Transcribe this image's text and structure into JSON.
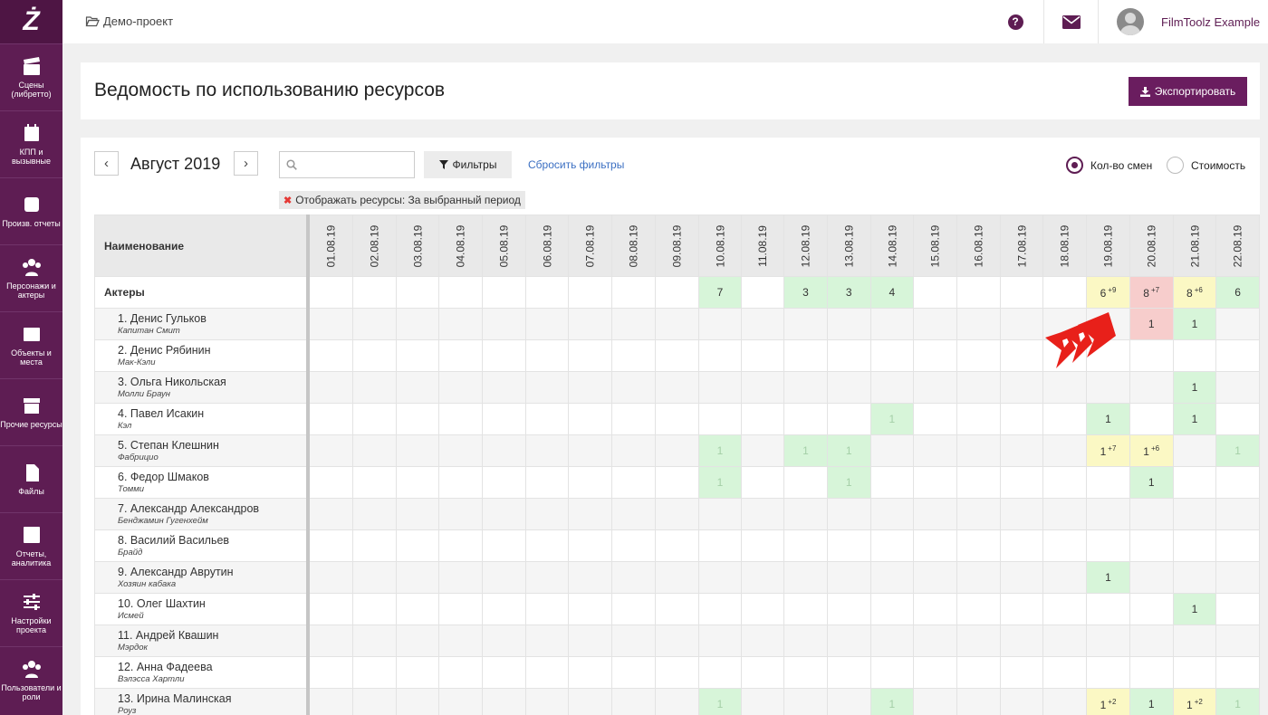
{
  "app": {
    "logo": "Ż"
  },
  "sidebar": {
    "items": [
      {
        "label": "Сцены (либретто)",
        "icon": "clapperboard-icon"
      },
      {
        "label": "КПП и вызывные",
        "icon": "calendar-icon"
      },
      {
        "label": "Произв. отчеты",
        "icon": "check-square-icon"
      },
      {
        "label": "Персонажи и актеры",
        "icon": "users-icon"
      },
      {
        "label": "Объекты и места",
        "icon": "image-icon"
      },
      {
        "label": "Прочие ресурсы",
        "icon": "archive-icon"
      },
      {
        "label": "Файлы",
        "icon": "file-icon"
      },
      {
        "label": "Отчеты, аналитика",
        "icon": "bar-chart-icon"
      },
      {
        "label": "Настройки проекта",
        "icon": "sliders-icon"
      },
      {
        "label": "Пользователи и роли",
        "icon": "user-group-icon"
      }
    ]
  },
  "topbar": {
    "breadcrumb": "Демо-проект",
    "help": "?",
    "user_name": "FilmToolz Example"
  },
  "header": {
    "title": "Ведомость по использованию ресурсов",
    "export_label": "Экспортировать"
  },
  "toolbar": {
    "prev": "‹",
    "next": "›",
    "month": "Август 2019",
    "search_placeholder": "",
    "filters_label": "Фильтры",
    "reset_label": "Сбросить фильтры",
    "radio_shifts": "Кол-во смен",
    "radio_cost": "Стоимость",
    "selected_radio": "shifts",
    "filter_tag": "Отображать ресурсы:  За выбранный период"
  },
  "grid": {
    "name_header": "Наименование",
    "dates": [
      "01.08.19",
      "02.08.19",
      "03.08.19",
      "04.08.19",
      "05.08.19",
      "06.08.19",
      "07.08.19",
      "08.08.19",
      "09.08.19",
      "10.08.19",
      "11.08.19",
      "12.08.19",
      "13.08.19",
      "14.08.19",
      "15.08.19",
      "16.08.19",
      "17.08.19",
      "18.08.19",
      "19.08.19",
      "20.08.19",
      "21.08.19",
      "22.08.19"
    ],
    "group": {
      "name": "Актеры",
      "cells": {
        "9": {
          "v": "7",
          "c": "g"
        },
        "11": {
          "v": "3",
          "c": "g"
        },
        "12": {
          "v": "3",
          "c": "g"
        },
        "13": {
          "v": "4",
          "c": "g"
        },
        "18": {
          "v": "6",
          "s": "+9",
          "c": "y"
        },
        "19": {
          "v": "8",
          "s": "+7",
          "c": "r"
        },
        "20": {
          "v": "8",
          "s": "+6",
          "c": "y"
        },
        "21": {
          "v": "6",
          "c": "g"
        }
      }
    },
    "rows": [
      {
        "name": "1. Денис Гульков",
        "role": "Капитан Смит",
        "cells": {
          "19": {
            "v": "1",
            "c": "r"
          },
          "20": {
            "v": "1",
            "c": "g"
          }
        }
      },
      {
        "name": "2. Денис Рябинин",
        "role": "Мак-Кэли",
        "cells": {}
      },
      {
        "name": "3. Ольга Никольская",
        "role": "Молли Браун",
        "cells": {
          "20": {
            "v": "1",
            "c": "g"
          }
        }
      },
      {
        "name": "4. Павел Исакин",
        "role": "Кэл",
        "cells": {
          "13": {
            "v": "1",
            "c": "g",
            "f": 1
          },
          "18": {
            "v": "1",
            "c": "g"
          },
          "20": {
            "v": "1",
            "c": "g"
          }
        }
      },
      {
        "name": "5. Степан Клешнин",
        "role": "Фабрицио",
        "cells": {
          "9": {
            "v": "1",
            "c": "g",
            "f": 1
          },
          "11": {
            "v": "1",
            "c": "g",
            "f": 1
          },
          "12": {
            "v": "1",
            "c": "g",
            "f": 1
          },
          "18": {
            "v": "1",
            "s": "+7",
            "c": "y"
          },
          "19": {
            "v": "1",
            "s": "+6",
            "c": "y"
          },
          "21": {
            "v": "1",
            "c": "g",
            "f": 1
          }
        }
      },
      {
        "name": "6. Федор Шмаков",
        "role": "Томми",
        "cells": {
          "9": {
            "v": "1",
            "c": "g",
            "f": 1
          },
          "12": {
            "v": "1",
            "c": "g",
            "f": 1
          },
          "19": {
            "v": "1",
            "c": "g"
          }
        }
      },
      {
        "name": "7. Александр Александров",
        "role": "Бенджамин Гугенхейм",
        "cells": {}
      },
      {
        "name": "8. Василий Васильев",
        "role": "Брайд",
        "cells": {}
      },
      {
        "name": "9. Александр Аврутин",
        "role": "Хозяин кабака",
        "cells": {
          "18": {
            "v": "1",
            "c": "g"
          }
        }
      },
      {
        "name": "10. Олег Шахтин",
        "role": "Исмей",
        "cells": {
          "20": {
            "v": "1",
            "c": "g"
          }
        }
      },
      {
        "name": "11. Андрей Квашин",
        "role": "Мэрдок",
        "cells": {}
      },
      {
        "name": "12. Анна Фадеева",
        "role": "Вэлэсса Хартли",
        "cells": {}
      },
      {
        "name": "13. Ирина Малинская",
        "role": "Роуз",
        "cells": {
          "9": {
            "v": "1",
            "c": "g",
            "f": 1
          },
          "13": {
            "v": "1",
            "c": "g",
            "f": 1
          },
          "18": {
            "v": "1",
            "s": "+2",
            "c": "y"
          },
          "19": {
            "v": "1",
            "c": "g"
          },
          "20": {
            "v": "1",
            "s": "+2",
            "c": "y"
          },
          "21": {
            "v": "1",
            "c": "g",
            "f": 1
          }
        }
      }
    ]
  },
  "colors": {
    "brand": "#5e1d53",
    "green": "#d7f5d9",
    "yellow": "#fbf8c4",
    "red": "#f7cdcc",
    "link": "#3b6fc2",
    "arrow": "#e8201a"
  }
}
